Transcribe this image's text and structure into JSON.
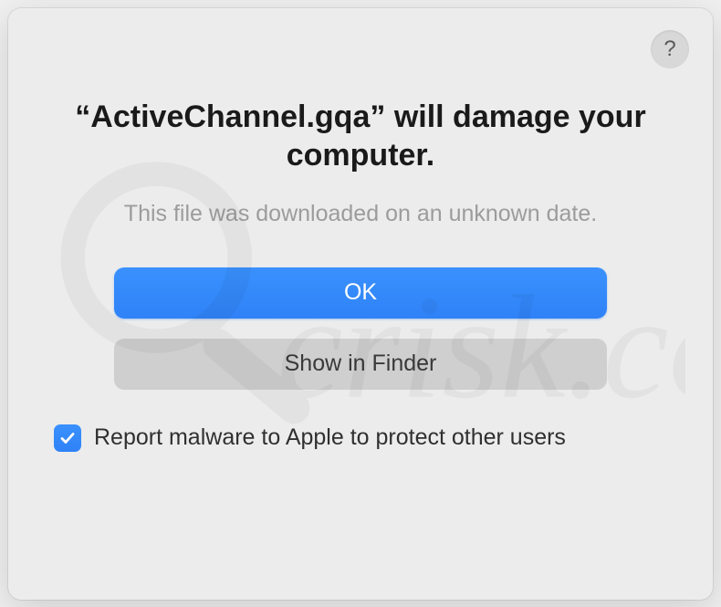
{
  "help_label": "?",
  "title_prefix": "“",
  "filename": "ActiveChannel.gqa",
  "title_suffix": "” will damage your computer.",
  "subtitle": "This file was downloaded on an unknown date.",
  "buttons": {
    "ok": "OK",
    "show_in_finder": "Show in Finder"
  },
  "checkbox": {
    "checked": true,
    "label": "Report malware to Apple to protect other users"
  },
  "colors": {
    "accent": "#2f82f7"
  }
}
